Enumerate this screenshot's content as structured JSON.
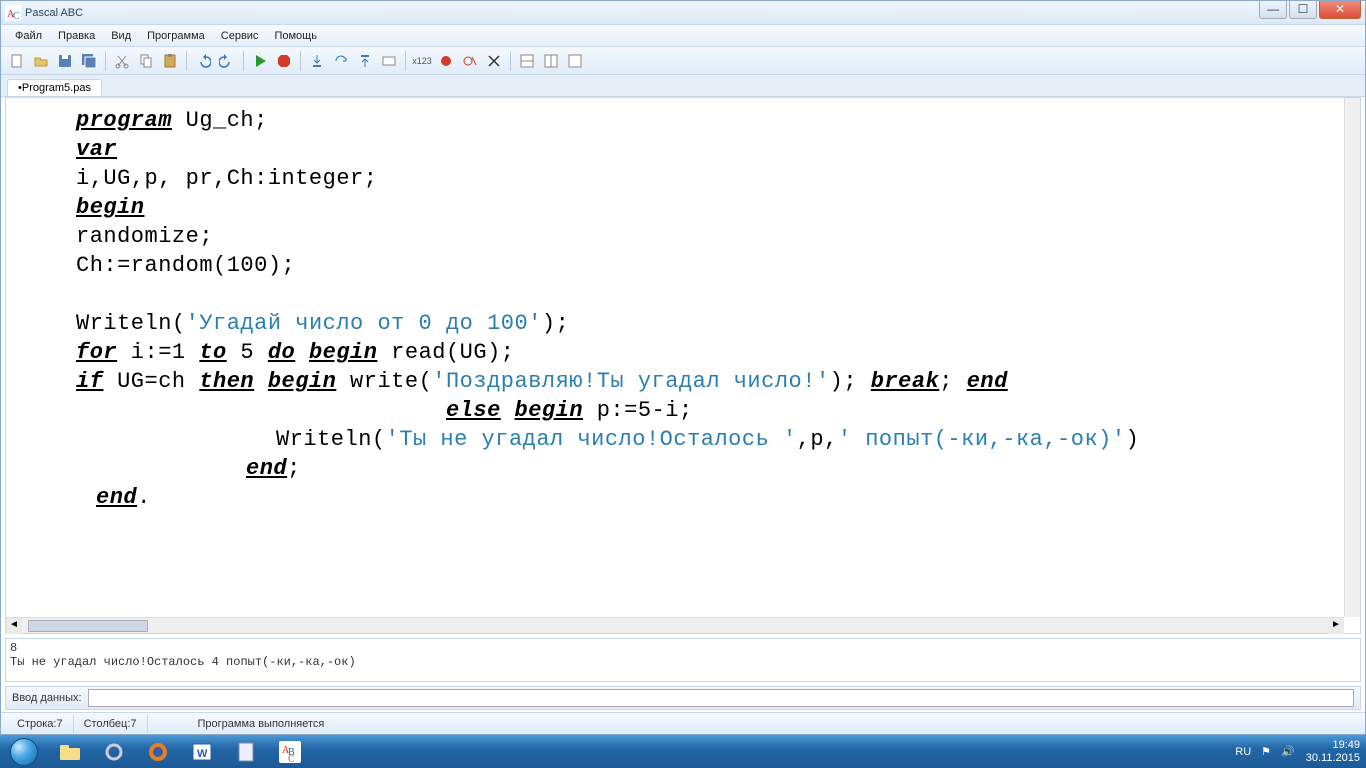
{
  "window": {
    "title": "Pascal ABC",
    "min": "—",
    "max": "☐",
    "close": "✕"
  },
  "menu": [
    "Файл",
    "Правка",
    "Вид",
    "Программа",
    "Сервис",
    "Помощь"
  ],
  "tab": "•Program5.pas",
  "code": {
    "l1a": "program",
    "l1b": " Ug_ch;",
    "l2": "var",
    "l3": "  i,UG,p, pr,Ch:integer;",
    "l4": "begin",
    "l5": "randomize;",
    "l6": "Ch:=random(100);",
    "l7a": "Writeln(",
    "l7s": "'Угадай число от 0 до 100'",
    "l7b": ");",
    "l8a": "for",
    "l8b": " i:=1 ",
    "l8c": "to",
    "l8d": " 5 ",
    "l8e": "do",
    "l8f": " ",
    "l8g": "begin",
    "l8h": " read(UG);",
    "l9a": "if",
    "l9b": " UG=ch ",
    "l9c": "then",
    "l9d": " ",
    "l9e": "begin",
    "l9f": " write(",
    "l9s": "'Поздравляю!Ты угадал число!'",
    "l9g": "); ",
    "l9h": "break",
    "l9i": "; ",
    "l9j": "end",
    "l10a": "else",
    "l10b": " ",
    "l10c": "begin",
    "l10d": " p:=5-i;",
    "l11a": "Writeln(",
    "l11s1": "'Ты не угадал число!Осталось '",
    "l11b": ",p,",
    "l11s2": "' попыт(-ки,-ка,-ок)'",
    "l11c": ")",
    "l12": "end",
    "l12b": ";",
    "l13": "end",
    "l13b": "."
  },
  "output": {
    "line1": "8",
    "line2": "Ты не угадал число!Осталось 4 попыт(-ки,-ка,-ок)"
  },
  "input_label": "Ввод данных:",
  "status": {
    "line_label": "Строка: ",
    "line_val": "7",
    "col_label": "Столбец: ",
    "col_val": "7",
    "state": "Программа выполняется"
  },
  "tray": {
    "lang": "RU",
    "time": "19:49",
    "date": "30.11.2015"
  }
}
